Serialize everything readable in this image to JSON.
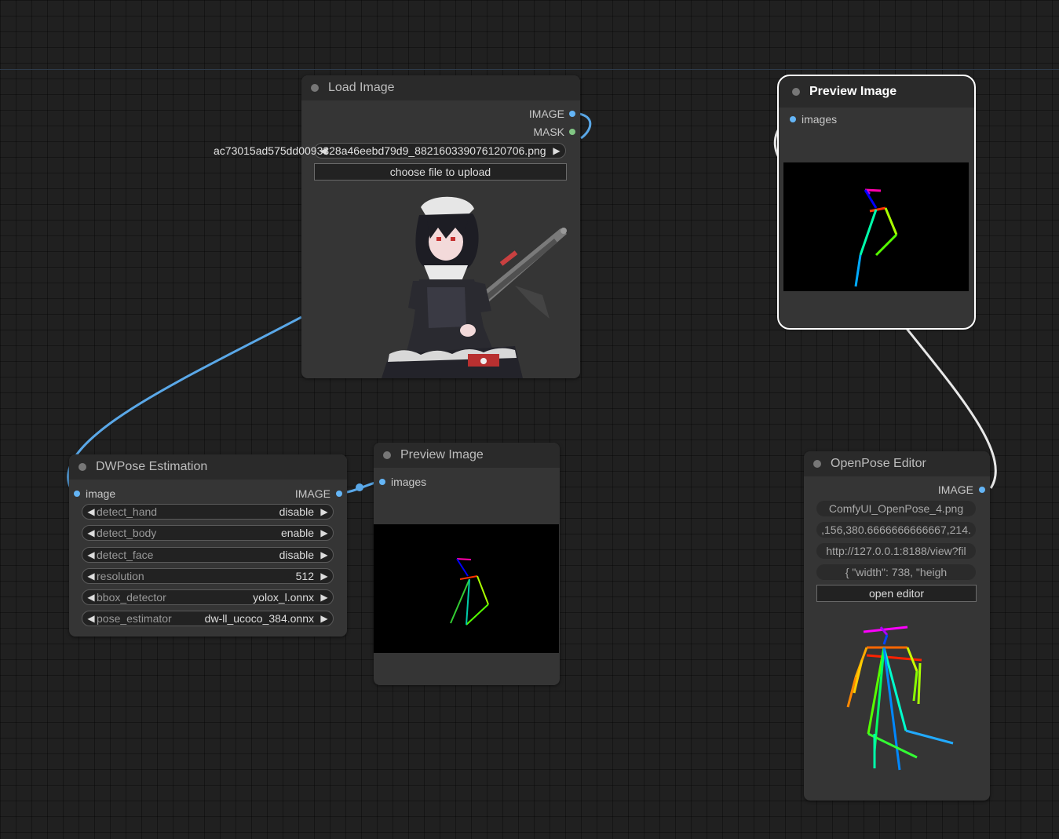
{
  "colors": {
    "canvas": "#202020",
    "node_body": "#353535",
    "node_title": "#2a2a2a",
    "image_slot": "#64b5f6",
    "mask_slot": "#81c784",
    "image_link": "#5aa8e8",
    "selected_outline": "#ffffff"
  },
  "load_image": {
    "title": "Load Image",
    "outputs": [
      "IMAGE",
      "MASK"
    ],
    "filename": "ac73015ad575dd0093328a46eebd79d9_882160339076120706.png",
    "upload_button": "choose file to upload",
    "image_icon": "anime-maid-character-image"
  },
  "preview_top": {
    "title": "Preview Image",
    "input": "images"
  },
  "dwpose": {
    "title": "DWPose Estimation",
    "input": "image",
    "output": "IMAGE",
    "widgets": [
      {
        "label": "detect_hand",
        "value": "disable"
      },
      {
        "label": "detect_body",
        "value": "enable"
      },
      {
        "label": "detect_face",
        "value": "disable"
      },
      {
        "label": "resolution",
        "value": "512"
      },
      {
        "label": "bbox_detector",
        "value": "yolox_l.onnx"
      },
      {
        "label": "pose_estimator",
        "value": "dw-ll_ucoco_384.onnx"
      }
    ]
  },
  "preview_mid": {
    "title": "Preview Image",
    "input": "images"
  },
  "openpose": {
    "title": "OpenPose Editor",
    "output": "IMAGE",
    "fields": [
      "ComfyUI_OpenPose_4.png",
      ",156,380.6666666666667,214.",
      "http://127.0.0.1:8188/view?fil",
      "{    \"width\": 738,    \"heigh"
    ],
    "open_button": "open editor"
  }
}
